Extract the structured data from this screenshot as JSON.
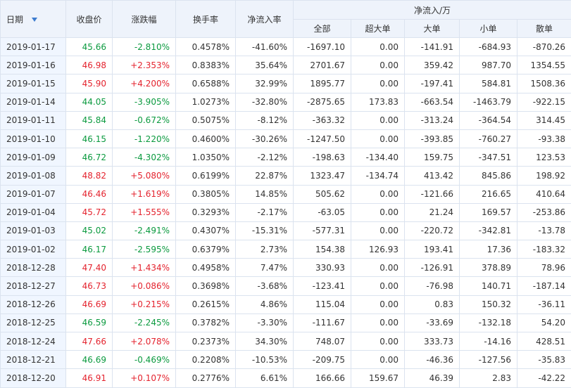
{
  "headers": {
    "date": "日期",
    "close": "收盘价",
    "change": "涨跌幅",
    "turnover": "换手率",
    "net_rate": "净流入率",
    "net_group": "净流入/万",
    "all": "全部",
    "super": "超大单",
    "large": "大单",
    "small": "小单",
    "retail": "散单"
  },
  "colors": {
    "up": "#e4232e",
    "down": "#0b9a3f",
    "header_bg": "#eef3fb"
  },
  "icons": {
    "sort": "sort-desc-icon"
  },
  "rows": [
    {
      "date": "2019-01-17",
      "close": "45.66",
      "change": "-2.810%",
      "turnover": "0.4578%",
      "net_rate": "-41.60%",
      "all": "-1697.10",
      "super": "0.00",
      "large": "-141.91",
      "small": "-684.93",
      "retail": "-870.26",
      "dir": "down"
    },
    {
      "date": "2019-01-16",
      "close": "46.98",
      "change": "+2.353%",
      "turnover": "0.8383%",
      "net_rate": "35.64%",
      "all": "2701.67",
      "super": "0.00",
      "large": "359.42",
      "small": "987.70",
      "retail": "1354.55",
      "dir": "up"
    },
    {
      "date": "2019-01-15",
      "close": "45.90",
      "change": "+4.200%",
      "turnover": "0.6588%",
      "net_rate": "32.99%",
      "all": "1895.77",
      "super": "0.00",
      "large": "-197.41",
      "small": "584.81",
      "retail": "1508.36",
      "dir": "up"
    },
    {
      "date": "2019-01-14",
      "close": "44.05",
      "change": "-3.905%",
      "turnover": "1.0273%",
      "net_rate": "-32.80%",
      "all": "-2875.65",
      "super": "173.83",
      "large": "-663.54",
      "small": "-1463.79",
      "retail": "-922.15",
      "dir": "down"
    },
    {
      "date": "2019-01-11",
      "close": "45.84",
      "change": "-0.672%",
      "turnover": "0.5075%",
      "net_rate": "-8.12%",
      "all": "-363.32",
      "super": "0.00",
      "large": "-313.24",
      "small": "-364.54",
      "retail": "314.45",
      "dir": "down"
    },
    {
      "date": "2019-01-10",
      "close": "46.15",
      "change": "-1.220%",
      "turnover": "0.4600%",
      "net_rate": "-30.26%",
      "all": "-1247.50",
      "super": "0.00",
      "large": "-393.85",
      "small": "-760.27",
      "retail": "-93.38",
      "dir": "down"
    },
    {
      "date": "2019-01-09",
      "close": "46.72",
      "change": "-4.302%",
      "turnover": "1.0350%",
      "net_rate": "-2.12%",
      "all": "-198.63",
      "super": "-134.40",
      "large": "159.75",
      "small": "-347.51",
      "retail": "123.53",
      "dir": "down"
    },
    {
      "date": "2019-01-08",
      "close": "48.82",
      "change": "+5.080%",
      "turnover": "0.6199%",
      "net_rate": "22.87%",
      "all": "1323.47",
      "super": "-134.74",
      "large": "413.42",
      "small": "845.86",
      "retail": "198.92",
      "dir": "up"
    },
    {
      "date": "2019-01-07",
      "close": "46.46",
      "change": "+1.619%",
      "turnover": "0.3805%",
      "net_rate": "14.85%",
      "all": "505.62",
      "super": "0.00",
      "large": "-121.66",
      "small": "216.65",
      "retail": "410.64",
      "dir": "up"
    },
    {
      "date": "2019-01-04",
      "close": "45.72",
      "change": "+1.555%",
      "turnover": "0.3293%",
      "net_rate": "-2.17%",
      "all": "-63.05",
      "super": "0.00",
      "large": "21.24",
      "small": "169.57",
      "retail": "-253.86",
      "dir": "up"
    },
    {
      "date": "2019-01-03",
      "close": "45.02",
      "change": "-2.491%",
      "turnover": "0.4307%",
      "net_rate": "-15.31%",
      "all": "-577.31",
      "super": "0.00",
      "large": "-220.72",
      "small": "-342.81",
      "retail": "-13.78",
      "dir": "down"
    },
    {
      "date": "2019-01-02",
      "close": "46.17",
      "change": "-2.595%",
      "turnover": "0.6379%",
      "net_rate": "2.73%",
      "all": "154.38",
      "super": "126.93",
      "large": "193.41",
      "small": "17.36",
      "retail": "-183.32",
      "dir": "down"
    },
    {
      "date": "2018-12-28",
      "close": "47.40",
      "change": "+1.434%",
      "turnover": "0.4958%",
      "net_rate": "7.47%",
      "all": "330.93",
      "super": "0.00",
      "large": "-126.91",
      "small": "378.89",
      "retail": "78.96",
      "dir": "up"
    },
    {
      "date": "2018-12-27",
      "close": "46.73",
      "change": "+0.086%",
      "turnover": "0.3698%",
      "net_rate": "-3.68%",
      "all": "-123.41",
      "super": "0.00",
      "large": "-76.98",
      "small": "140.71",
      "retail": "-187.14",
      "dir": "up"
    },
    {
      "date": "2018-12-26",
      "close": "46.69",
      "change": "+0.215%",
      "turnover": "0.2615%",
      "net_rate": "4.86%",
      "all": "115.04",
      "super": "0.00",
      "large": "0.83",
      "small": "150.32",
      "retail": "-36.11",
      "dir": "up"
    },
    {
      "date": "2018-12-25",
      "close": "46.59",
      "change": "-2.245%",
      "turnover": "0.3782%",
      "net_rate": "-3.30%",
      "all": "-111.67",
      "super": "0.00",
      "large": "-33.69",
      "small": "-132.18",
      "retail": "54.20",
      "dir": "down"
    },
    {
      "date": "2018-12-24",
      "close": "47.66",
      "change": "+2.078%",
      "turnover": "0.2373%",
      "net_rate": "34.30%",
      "all": "748.07",
      "super": "0.00",
      "large": "333.73",
      "small": "-14.16",
      "retail": "428.51",
      "dir": "up"
    },
    {
      "date": "2018-12-21",
      "close": "46.69",
      "change": "-0.469%",
      "turnover": "0.2208%",
      "net_rate": "-10.53%",
      "all": "-209.75",
      "super": "0.00",
      "large": "-46.36",
      "small": "-127.56",
      "retail": "-35.83",
      "dir": "down"
    },
    {
      "date": "2018-12-20",
      "close": "46.91",
      "change": "+0.107%",
      "turnover": "0.2776%",
      "net_rate": "6.61%",
      "all": "166.66",
      "super": "159.67",
      "large": "46.39",
      "small": "2.83",
      "retail": "-42.22",
      "dir": "up"
    }
  ]
}
